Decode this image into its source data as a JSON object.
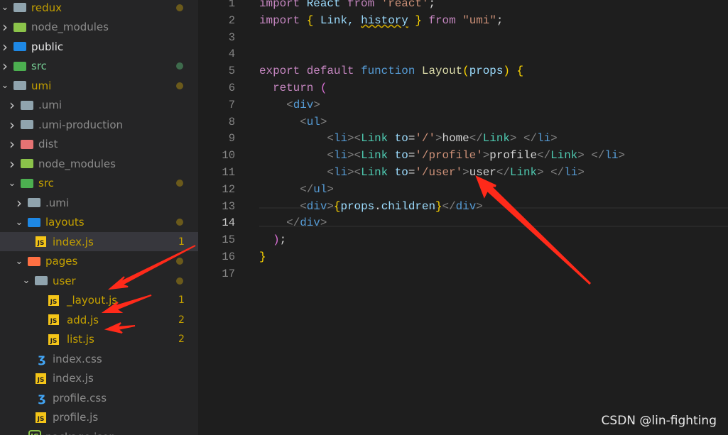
{
  "explorer": {
    "items": [
      {
        "label": "redux",
        "level": 0,
        "type": "folder",
        "open": true,
        "icon": "folder-open-icon",
        "color": "#c4a000",
        "dot": "#6b5a1b"
      },
      {
        "label": "node_modules",
        "level": 0,
        "type": "folder",
        "icon": "node-folder-icon",
        "color": "#8c8c8c"
      },
      {
        "label": "public",
        "level": 0,
        "type": "folder",
        "icon": "public-folder-icon",
        "color": "#e8e8e8"
      },
      {
        "label": "src",
        "level": 0,
        "type": "folder",
        "icon": "src-folder-icon",
        "color": "#73c991",
        "dot": "#3e6b4c"
      },
      {
        "label": "umi",
        "level": 0,
        "type": "folder",
        "open": true,
        "icon": "folder-open-icon",
        "color": "#c4a000",
        "dot": "#6b5a1b"
      },
      {
        "label": ".umi",
        "level": 1,
        "type": "folder",
        "icon": "folder-icon",
        "color": "#8c8c8c"
      },
      {
        "label": ".umi-production",
        "level": 1,
        "type": "folder",
        "icon": "folder-icon",
        "color": "#8c8c8c"
      },
      {
        "label": "dist",
        "level": 1,
        "type": "folder",
        "icon": "dist-folder-icon",
        "color": "#8c8c8c"
      },
      {
        "label": "node_modules",
        "level": 1,
        "type": "folder",
        "icon": "node-folder-icon",
        "color": "#8c8c8c"
      },
      {
        "label": "src",
        "level": 1,
        "type": "folder",
        "open": true,
        "icon": "src-folder-icon",
        "color": "#c4a000",
        "dot": "#6b5a1b"
      },
      {
        "label": ".umi",
        "level": 2,
        "type": "folder",
        "icon": "folder-icon",
        "color": "#8c8c8c"
      },
      {
        "label": "layouts",
        "level": 2,
        "type": "folder",
        "open": true,
        "icon": "layout-folder-icon",
        "color": "#c4a000",
        "dot": "#6b5a1b"
      },
      {
        "label": "index.js",
        "level": 3,
        "type": "js",
        "icon": "js-file-icon",
        "color": "#c4a000",
        "badge": "1",
        "selected": true
      },
      {
        "label": "pages",
        "level": 2,
        "type": "folder",
        "open": true,
        "icon": "pages-folder-icon",
        "color": "#c4a000",
        "dot": "#6b5a1b"
      },
      {
        "label": "user",
        "level": 3,
        "type": "folder",
        "open": true,
        "icon": "folder-open-icon",
        "color": "#c4a000",
        "dot": "#6b5a1b"
      },
      {
        "label": "_layout.js",
        "level": 4,
        "type": "js",
        "icon": "js-file-icon",
        "color": "#c4a000",
        "badge": "1"
      },
      {
        "label": "add.js",
        "level": 4,
        "type": "js",
        "icon": "js-file-icon",
        "color": "#c4a000",
        "badge": "2"
      },
      {
        "label": "list.js",
        "level": 4,
        "type": "js",
        "icon": "js-file-icon",
        "color": "#c4a000",
        "badge": "2"
      },
      {
        "label": "index.css",
        "level": 3,
        "type": "css",
        "icon": "css-file-icon",
        "color": "#8c8c8c"
      },
      {
        "label": "index.js",
        "level": 3,
        "type": "js",
        "icon": "js-file-icon",
        "color": "#8c8c8c"
      },
      {
        "label": "profile.css",
        "level": 3,
        "type": "css",
        "icon": "css-file-icon",
        "color": "#8c8c8c"
      },
      {
        "label": "profile.js",
        "level": 3,
        "type": "js",
        "icon": "js-file-icon",
        "color": "#8c8c8c"
      },
      {
        "label": "package.json",
        "level": 2,
        "type": "json",
        "icon": "node-json-icon",
        "color": "#8c8c8c"
      }
    ]
  },
  "editor": {
    "current_line": 14,
    "lines": [
      {
        "n": "1",
        "tokens": [
          [
            "import",
            "kw"
          ],
          [
            " React ",
            "id"
          ],
          [
            "from",
            "kw"
          ],
          [
            " ",
            "txtc"
          ],
          [
            "'react'",
            "str"
          ],
          [
            ";",
            "txtc"
          ]
        ]
      },
      {
        "n": "2",
        "tokens": [
          [
            "import",
            "kw"
          ],
          [
            " ",
            "txtc"
          ],
          [
            "{",
            "gold"
          ],
          [
            " Link, ",
            "id"
          ],
          [
            "history",
            "id wavy"
          ],
          [
            " ",
            "txtc"
          ],
          [
            "}",
            "gold"
          ],
          [
            " ",
            "txtc"
          ],
          [
            "from",
            "kw"
          ],
          [
            " ",
            "txtc"
          ],
          [
            "\"umi\"",
            "str"
          ],
          [
            ";",
            "txtc"
          ]
        ]
      },
      {
        "n": "3",
        "tokens": []
      },
      {
        "n": "4",
        "tokens": []
      },
      {
        "n": "5",
        "tokens": [
          [
            "export",
            "kw"
          ],
          [
            " ",
            "txtc"
          ],
          [
            "default",
            "kw"
          ],
          [
            " ",
            "txtc"
          ],
          [
            "function",
            "fn"
          ],
          [
            " ",
            "txtc"
          ],
          [
            "Layout",
            "fnname"
          ],
          [
            "(",
            "gold"
          ],
          [
            "props",
            "id"
          ],
          [
            ")",
            "gold"
          ],
          [
            " ",
            "txtc"
          ],
          [
            "{",
            "gold"
          ]
        ]
      },
      {
        "n": "6",
        "tokens": [
          [
            "  ",
            "txtc"
          ],
          [
            "return",
            "kw"
          ],
          [
            " ",
            "txtc"
          ],
          [
            "(",
            "pink"
          ]
        ]
      },
      {
        "n": "7",
        "tokens": [
          [
            "    ",
            "txtc"
          ],
          [
            "<",
            "br"
          ],
          [
            "div",
            "tag"
          ],
          [
            ">",
            "br"
          ]
        ]
      },
      {
        "n": "8",
        "tokens": [
          [
            "      ",
            "txtc"
          ],
          [
            "<",
            "br"
          ],
          [
            "ul",
            "tag"
          ],
          [
            ">",
            "br"
          ]
        ]
      },
      {
        "n": "9",
        "tokens": [
          [
            "          ",
            "txtc"
          ],
          [
            "<",
            "br"
          ],
          [
            "li",
            "tag"
          ],
          [
            "><",
            "br"
          ],
          [
            "Link",
            "cmp"
          ],
          [
            " to",
            "id"
          ],
          [
            "=",
            "txtc"
          ],
          [
            "'/'",
            "str"
          ],
          [
            ">",
            "br"
          ],
          [
            "home",
            "txtc"
          ],
          [
            "</",
            "br"
          ],
          [
            "Link",
            "cmp"
          ],
          [
            "> </",
            "br"
          ],
          [
            "li",
            "tag"
          ],
          [
            ">",
            "br"
          ]
        ]
      },
      {
        "n": "10",
        "tokens": [
          [
            "          ",
            "txtc"
          ],
          [
            "<",
            "br"
          ],
          [
            "li",
            "tag"
          ],
          [
            "><",
            "br"
          ],
          [
            "Link",
            "cmp"
          ],
          [
            " to",
            "id"
          ],
          [
            "=",
            "txtc"
          ],
          [
            "'/profile'",
            "str"
          ],
          [
            ">",
            "br"
          ],
          [
            "profile",
            "txtc"
          ],
          [
            "</",
            "br"
          ],
          [
            "Link",
            "cmp"
          ],
          [
            "> </",
            "br"
          ],
          [
            "li",
            "tag"
          ],
          [
            ">",
            "br"
          ]
        ]
      },
      {
        "n": "11",
        "tokens": [
          [
            "          ",
            "txtc"
          ],
          [
            "<",
            "br"
          ],
          [
            "li",
            "tag"
          ],
          [
            "><",
            "br"
          ],
          [
            "Link",
            "cmp"
          ],
          [
            " to",
            "id"
          ],
          [
            "=",
            "txtc"
          ],
          [
            "'/user'",
            "str"
          ],
          [
            ">",
            "br"
          ],
          [
            "user",
            "txtc"
          ],
          [
            "</",
            "br"
          ],
          [
            "Link",
            "cmp"
          ],
          [
            "> </",
            "br"
          ],
          [
            "li",
            "tag"
          ],
          [
            ">",
            "br"
          ]
        ]
      },
      {
        "n": "12",
        "tokens": [
          [
            "      ",
            "txtc"
          ],
          [
            "</",
            "br"
          ],
          [
            "ul",
            "tag"
          ],
          [
            ">",
            "br"
          ]
        ]
      },
      {
        "n": "13",
        "tokens": [
          [
            "      ",
            "txtc"
          ],
          [
            "<",
            "br"
          ],
          [
            "div",
            "tag"
          ],
          [
            ">",
            "br"
          ],
          [
            "{",
            "gold"
          ],
          [
            "props",
            "id"
          ],
          [
            ".",
            "txtc"
          ],
          [
            "children",
            "id"
          ],
          [
            "}",
            "gold"
          ],
          [
            "</",
            "br"
          ],
          [
            "div",
            "tag"
          ],
          [
            ">",
            "br"
          ]
        ]
      },
      {
        "n": "14",
        "tokens": [
          [
            "    ",
            "txtc"
          ],
          [
            "</",
            "br"
          ],
          [
            "div",
            "tag"
          ],
          [
            ">",
            "br"
          ]
        ]
      },
      {
        "n": "15",
        "tokens": [
          [
            "  ",
            "txtc"
          ],
          [
            ")",
            "pink"
          ],
          [
            ";",
            "txtc"
          ]
        ]
      },
      {
        "n": "16",
        "tokens": [
          [
            "}",
            "gold"
          ]
        ]
      },
      {
        "n": "17",
        "tokens": []
      }
    ]
  },
  "watermark": "CSDN @lin-fighting",
  "colors": {
    "annotation_arrow": "#ff2a1a",
    "sidebar_bg": "#252526",
    "editor_bg": "#1e1e1e"
  }
}
